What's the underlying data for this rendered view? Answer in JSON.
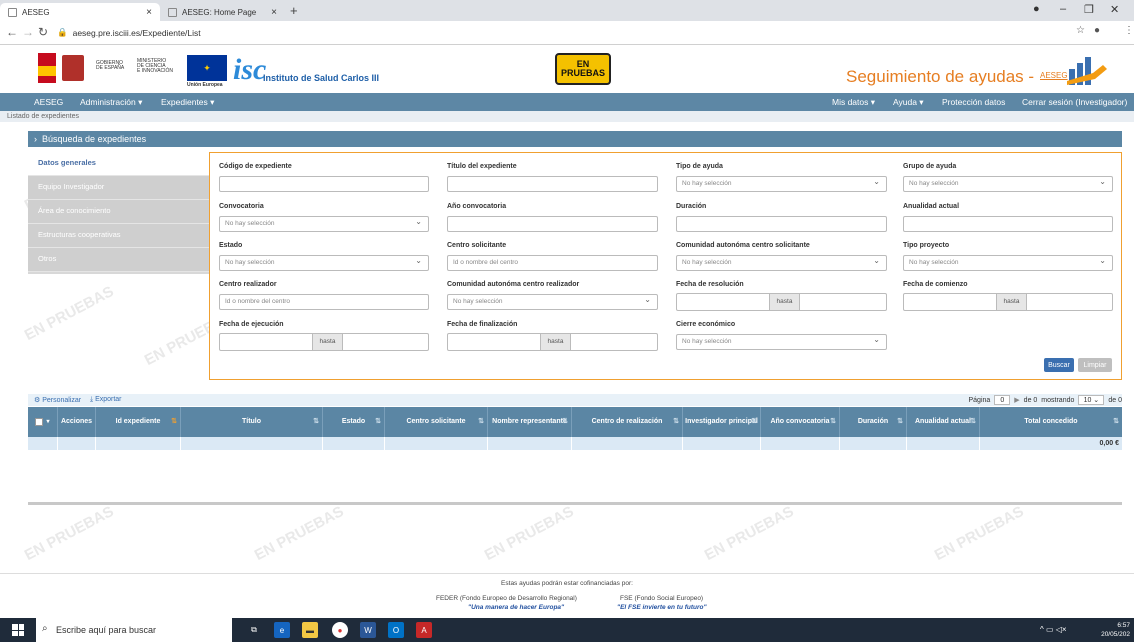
{
  "browser": {
    "tabs": [
      {
        "label": "AESEG"
      },
      {
        "label": "AESEG: Home Page"
      }
    ],
    "new_tab": "+",
    "url": "aeseg.pre.isciii.es/Expediente/List"
  },
  "header": {
    "gob_lines": [
      "GOBIERNO",
      "DE ESPAÑA"
    ],
    "min_lines": [
      "MINISTERIO",
      "DE CIENCIA",
      "E INNOVACIÓN"
    ],
    "eu_label": "Unión Europea",
    "isciii_logo": "isc",
    "isciii_name": "Instituto de Salud Carlos III",
    "badge_top": "EN",
    "badge_bottom": "PRUEBAS",
    "app_title": "Seguimiento de ayudas -",
    "app_logo": "AESEG"
  },
  "nav": {
    "brand": "AESEG",
    "admin": "Administración ▾",
    "expedientes": "Expedientes ▾",
    "mis_datos": "Mis datos ▾",
    "ayuda": "Ayuda ▾",
    "proteccion": "Protección datos",
    "logout": "Cerrar sesión (Investigador)"
  },
  "breadcrumb": "Listado de expedientes",
  "search": {
    "title": "Búsqueda de expedientes",
    "side": [
      "Datos generales",
      "Equipo Investigador",
      "Área de conocimiento",
      "Estructuras cooperativas",
      "Otros"
    ],
    "fields": {
      "codigo": "Código de expediente",
      "titulo": "Título del expediente",
      "tipo": "Tipo de ayuda",
      "grupo": "Grupo de ayuda",
      "convocatoria": "Convocatoria",
      "anio": "Año convocatoria",
      "duracion": "Duración",
      "anualidad": "Anualidad actual",
      "estado": "Estado",
      "centro_sol": "Centro solicitante",
      "comunidad_sol": "Comunidad autonóma centro solicitante",
      "tipo_proyecto": "Tipo proyecto",
      "centro_real": "Centro realizador",
      "comunidad_real": "Comunidad autonóma centro realizador",
      "fecha_res": "Fecha de resolución",
      "fecha_com": "Fecha de comienzo",
      "fecha_ejec": "Fecha de ejecución",
      "fecha_fin": "Fecha de finalización",
      "cierre": "Cierre económico"
    },
    "no_sel": "No hay selección",
    "centro_ph": "Id o nombre del centro",
    "hasta": "hasta",
    "buscar": "Buscar",
    "limpiar": "Limpiar"
  },
  "results": {
    "personalizar": "Personalizar",
    "exportar": "Exportar",
    "pagina": "Página",
    "page_num": "0",
    "de": "de 0",
    "mostrando": "mostrando",
    "per_page": "10",
    "de_total": "de 0",
    "columns": [
      "Acciones",
      "Id expediente",
      "Título",
      "Estado",
      "Centro solicitante",
      "Nombre representante",
      "Centro de realización",
      "Investigador principal",
      "Año convocatoria",
      "Duración",
      "Anualidad actual",
      "Total concedido"
    ],
    "total": "0,00 €"
  },
  "watermark": "EN PRUEBAS",
  "footer": {
    "line1": "Estas ayudas podrán estar cofinanciadas por:",
    "feder": "FEDER (Fondo Europeo de Desarrollo Regional)",
    "feder_q": "\"Una manera de hacer Europa\"",
    "fse": "FSE (Fondo Social Europeo)",
    "fse_q": "\"El FSE invierte en tu futuro\""
  },
  "taskbar": {
    "search": "Escribe aquí para buscar",
    "time": "6:57",
    "date": "20/05/202"
  }
}
